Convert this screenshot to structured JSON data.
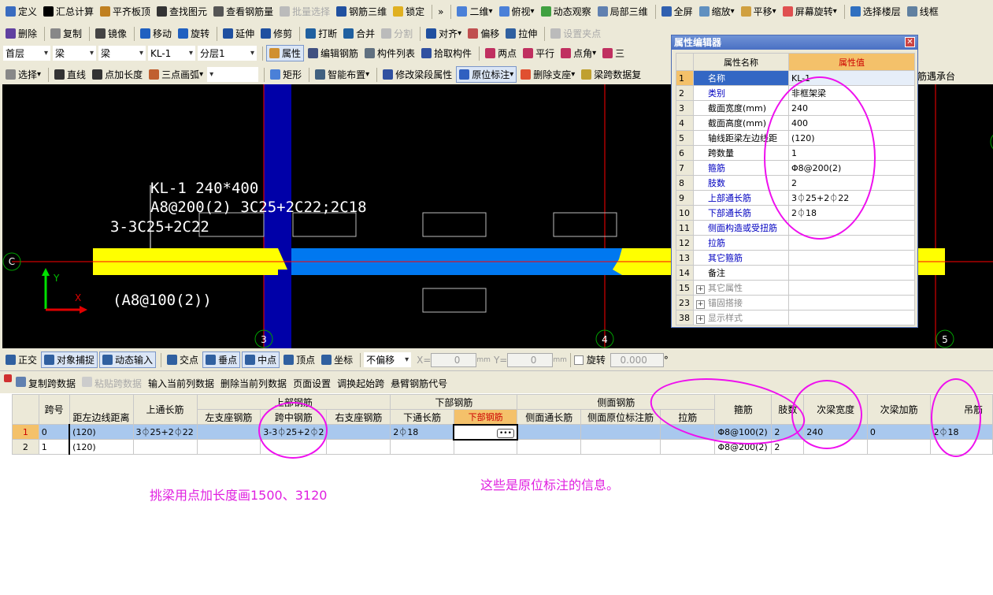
{
  "toolbar1": [
    {
      "label": "定义",
      "icon": "define-icon",
      "color": "#3a6cc0"
    },
    {
      "label": "汇总计算",
      "icon": "sigma-icon",
      "color": "#000"
    },
    {
      "label": "平齐板顶",
      "icon": "align-slab-icon",
      "color": "#c08020"
    },
    {
      "label": "查找图元",
      "icon": "binoculars-icon",
      "color": "#333"
    },
    {
      "label": "查看钢筋量",
      "icon": "glasses-icon",
      "color": "#555"
    },
    {
      "label": "批量选择",
      "icon": "batch-select-icon",
      "color": "#bbb",
      "disabled": true
    },
    {
      "label": "钢筋三维",
      "icon": "rebar-3d-icon",
      "color": "#2050a0"
    },
    {
      "label": "锁定",
      "icon": "lock-icon",
      "color": "#e0b020"
    },
    {
      "label": "»",
      "icon": "more-icon",
      "color": ""
    },
    {
      "label": "二维",
      "icon": "2d-icon",
      "color": "#4a80d8",
      "dropdown": true
    },
    {
      "label": "俯视",
      "icon": "top-view-icon",
      "color": "#4a80d8",
      "dropdown": true
    },
    {
      "label": "动态观察",
      "icon": "orbit-icon",
      "color": "#40a040"
    },
    {
      "label": "局部三维",
      "icon": "local-3d-icon",
      "color": "#6080b0"
    },
    {
      "label": "全屏",
      "icon": "fullscreen-icon",
      "color": "#3060b0"
    },
    {
      "label": "缩放",
      "icon": "zoom-icon",
      "color": "#6090c0",
      "dropdown": true
    },
    {
      "label": "平移",
      "icon": "pan-icon",
      "color": "#d0a040",
      "dropdown": true
    },
    {
      "label": "屏幕旋转",
      "icon": "screen-rotate-icon",
      "color": "#e05050",
      "dropdown": true
    },
    {
      "label": "选择楼层",
      "icon": "select-floor-icon",
      "color": "#3070c0"
    },
    {
      "label": "线框",
      "icon": "wireframe-icon",
      "color": "#6080a0"
    }
  ],
  "toolbar2": [
    {
      "label": "删除",
      "icon": "delete-icon",
      "color": "#6040a0"
    },
    {
      "label": "复制",
      "icon": "copy-icon",
      "color": "#888"
    },
    {
      "label": "镜像",
      "icon": "mirror-icon",
      "color": "#444"
    },
    {
      "label": "移动",
      "icon": "move-icon",
      "color": "#2060c0"
    },
    {
      "label": "旋转",
      "icon": "rotate-icon",
      "color": "#2060c0"
    },
    {
      "label": "延伸",
      "icon": "extend-icon",
      "color": "#2050a0"
    },
    {
      "label": "修剪",
      "icon": "trim-icon",
      "color": "#2050a0"
    },
    {
      "label": "打断",
      "icon": "break-icon",
      "color": "#2060a0"
    },
    {
      "label": "合并",
      "icon": "merge-icon",
      "color": "#2060a0"
    },
    {
      "label": "分割",
      "icon": "split-icon",
      "color": "#bbb",
      "disabled": true
    },
    {
      "label": "对齐",
      "icon": "align-icon",
      "color": "#2050a0",
      "dropdown": true
    },
    {
      "label": "偏移",
      "icon": "offset-icon",
      "color": "#c05050"
    },
    {
      "label": "拉伸",
      "icon": "stretch-icon",
      "color": "#3060a0"
    },
    {
      "label": "设置夹点",
      "icon": "grip-icon",
      "color": "#bbb",
      "disabled": true
    }
  ],
  "toolbar3": {
    "selects": [
      "首层",
      "梁",
      "梁",
      "KL-1",
      "分层1"
    ],
    "items": [
      {
        "label": "属性",
        "icon": "properties-icon",
        "color": "#d09030",
        "active": true
      },
      {
        "label": "编辑钢筋",
        "icon": "edit-rebar-icon",
        "color": "#405080"
      },
      {
        "label": "构件列表",
        "icon": "component-list-icon",
        "color": "#607080"
      },
      {
        "label": "拾取构件",
        "icon": "pick-component-icon",
        "color": "#3050a0"
      },
      {
        "label": "两点",
        "icon": "two-point-axis-icon",
        "color": "#c03060"
      },
      {
        "label": "平行",
        "icon": "parallel-axis-icon",
        "color": "#c03060"
      },
      {
        "label": "点角",
        "icon": "point-angle-icon",
        "color": "#c03060",
        "dropdown": true
      },
      {
        "label": "三",
        "icon": "three-point-axis-icon",
        "color": "#c03060"
      }
    ]
  },
  "toolbar4": [
    {
      "label": "选择",
      "icon": "pointer-icon",
      "color": "#888",
      "dropdown": true
    },
    {
      "label": "直线",
      "icon": "line-icon",
      "color": "#333"
    },
    {
      "label": "点加长度",
      "icon": "point-length-icon",
      "color": "#333"
    },
    {
      "label": "三点画弧",
      "icon": "arc-icon",
      "color": "#c06030",
      "dropdown": true
    },
    {
      "label": "",
      "icon": "",
      "color": "",
      "blank_select": true
    },
    {
      "label": "矩形",
      "icon": "rectangle-icon",
      "color": "#4a80d8"
    },
    {
      "label": "智能布置",
      "icon": "smart-layout-icon",
      "color": "#406080",
      "dropdown": true
    },
    {
      "label": "修改梁段属性",
      "icon": "modify-segment-icon",
      "color": "#3050a0"
    },
    {
      "label": "原位标注",
      "icon": "in-situ-label-icon",
      "color": "#3060c0",
      "active": true,
      "dropdown": true
    },
    {
      "label": "删除支座",
      "icon": "delete-support-icon",
      "color": "#e05030",
      "dropdown": true
    },
    {
      "label": "梁跨数据复",
      "icon": "copy-span-icon",
      "color": "#c0a030"
    }
  ],
  "toolbar4_right": "筋遇承台",
  "canvas": {
    "labels": {
      "line1": "KL-1 240*400",
      "line2": "A8@200(2) 3C25+2C22;2C18",
      "line3": "3-3C25+2C22",
      "stirrup": "(A8@100(2))"
    },
    "axes": {
      "c": "C",
      "a3": "3",
      "a4": "4",
      "a5": "5"
    },
    "ucs": {
      "x": "X",
      "y": "Y"
    },
    "colors": {
      "beam_yellow": "#ffff00",
      "beam_blue": "#0078f0",
      "column": "#0000a8",
      "axis": "#ff0000"
    }
  },
  "property_editor": {
    "title": "属性编辑器",
    "col_name": "属性名称",
    "col_value": "属性值",
    "rows": [
      {
        "n": "1",
        "name": "名称",
        "value": "KL-1",
        "style": "sel"
      },
      {
        "n": "2",
        "name": "类别",
        "value": "非框架梁",
        "style": "blue"
      },
      {
        "n": "3",
        "name": "截面宽度(mm)",
        "value": "240",
        "style": ""
      },
      {
        "n": "4",
        "name": "截面高度(mm)",
        "value": "400",
        "style": ""
      },
      {
        "n": "5",
        "name": "轴线距梁左边线距",
        "value": "(120)",
        "style": ""
      },
      {
        "n": "6",
        "name": "跨数量",
        "value": "1",
        "style": ""
      },
      {
        "n": "7",
        "name": "箍筋",
        "value": "Φ8@200(2)",
        "style": "blue"
      },
      {
        "n": "8",
        "name": "肢数",
        "value": "2",
        "style": "blue"
      },
      {
        "n": "9",
        "name": "上部通长筋",
        "value": "3⏀25+2⏀22",
        "style": "blue"
      },
      {
        "n": "10",
        "name": "下部通长筋",
        "value": "2⏀18",
        "style": "blue"
      },
      {
        "n": "11",
        "name": "侧面构造或受扭筋",
        "value": "",
        "style": "blue"
      },
      {
        "n": "12",
        "name": "拉筋",
        "value": "",
        "style": "blue"
      },
      {
        "n": "13",
        "name": "其它箍筋",
        "value": "",
        "style": "blue"
      },
      {
        "n": "14",
        "name": "备注",
        "value": "",
        "style": ""
      },
      {
        "n": "15",
        "name": "其它属性",
        "value": "",
        "style": "group"
      },
      {
        "n": "23",
        "name": "锚固搭接",
        "value": "",
        "style": "group"
      },
      {
        "n": "38",
        "name": "显示样式",
        "value": "",
        "style": "group"
      }
    ]
  },
  "snap_bar": {
    "items": [
      {
        "label": "正交",
        "icon": "ortho-icon"
      },
      {
        "label": "对象捕捉",
        "icon": "object-snap-icon",
        "active": true
      },
      {
        "label": "动态输入",
        "icon": "dynamic-input-icon",
        "active": true
      },
      {
        "label": "交点",
        "icon": "intersection-icon"
      },
      {
        "label": "垂点",
        "icon": "perpendicular-icon",
        "active": true
      },
      {
        "label": "中点",
        "icon": "midpoint-icon",
        "active": true
      },
      {
        "label": "顶点",
        "icon": "vertex-icon"
      },
      {
        "label": "坐标",
        "icon": "coordinate-icon"
      }
    ],
    "offset_select": "不偏移",
    "x_label": "X=",
    "x_value": "0",
    "y_label": "Y=",
    "y_value": "0",
    "unit": "mm",
    "rotate_label": "旋转",
    "rotate_value": "0.000",
    "degree": "°"
  },
  "grid_toolbar": [
    {
      "label": "复制跨数据",
      "disabled": false
    },
    {
      "label": "粘贴跨数据",
      "disabled": true
    },
    {
      "label": "输入当前列数据"
    },
    {
      "label": "删除当前列数据"
    },
    {
      "label": "页面设置"
    },
    {
      "label": "调换起始跨"
    },
    {
      "label": "悬臂钢筋代号"
    }
  ],
  "grid": {
    "h_span": "跨号",
    "h_dist": "距左边线距离",
    "h_top_through": "上通长筋",
    "h_top": "上部钢筋",
    "h_left_support": "左支座钢筋",
    "h_mid": "跨中钢筋",
    "h_right_support": "右支座钢筋",
    "h_bottom": "下部钢筋",
    "h_bottom_through": "下通长筋",
    "h_bottom_rebar": "下部钢筋",
    "h_side": "侧面钢筋",
    "h_side_through": "侧面通长筋",
    "h_side_insitu": "侧面原位标注筋",
    "h_tie": "拉筋",
    "h_stirrup": "箍筋",
    "h_legs": "肢数",
    "h_sec_width": "次梁宽度",
    "h_sec_add": "次梁加筋",
    "h_hanger": "吊筋",
    "rows": [
      {
        "n": "1",
        "span": "0",
        "dist": "(120)",
        "top_through": "3⏀25+2⏀22",
        "left": "",
        "mid": "3-3⏀25+2⏀2",
        "right": "",
        "bottom_through": "2⏀18",
        "bottom": "",
        "side_through": "",
        "side_insitu": "",
        "tie": "",
        "stirrup": "Φ8@100(2)",
        "legs": "2",
        "sec_width": "240",
        "sec_add": "0",
        "hanger": "2⏀18"
      },
      {
        "n": "2",
        "span": "1",
        "dist": "(120)",
        "top_through": "",
        "left": "",
        "mid": "",
        "right": "",
        "bottom_through": "",
        "bottom": "",
        "side_through": "",
        "side_insitu": "",
        "tie": "",
        "stirrup": "Φ8@200(2)",
        "legs": "2",
        "sec_width": "",
        "sec_add": "",
        "hanger": ""
      }
    ]
  },
  "annotations": {
    "note_left": "挑梁用点加长度画1500、3120",
    "note_right": "这些是原位标注的信息。",
    "color": "#e020e0"
  }
}
